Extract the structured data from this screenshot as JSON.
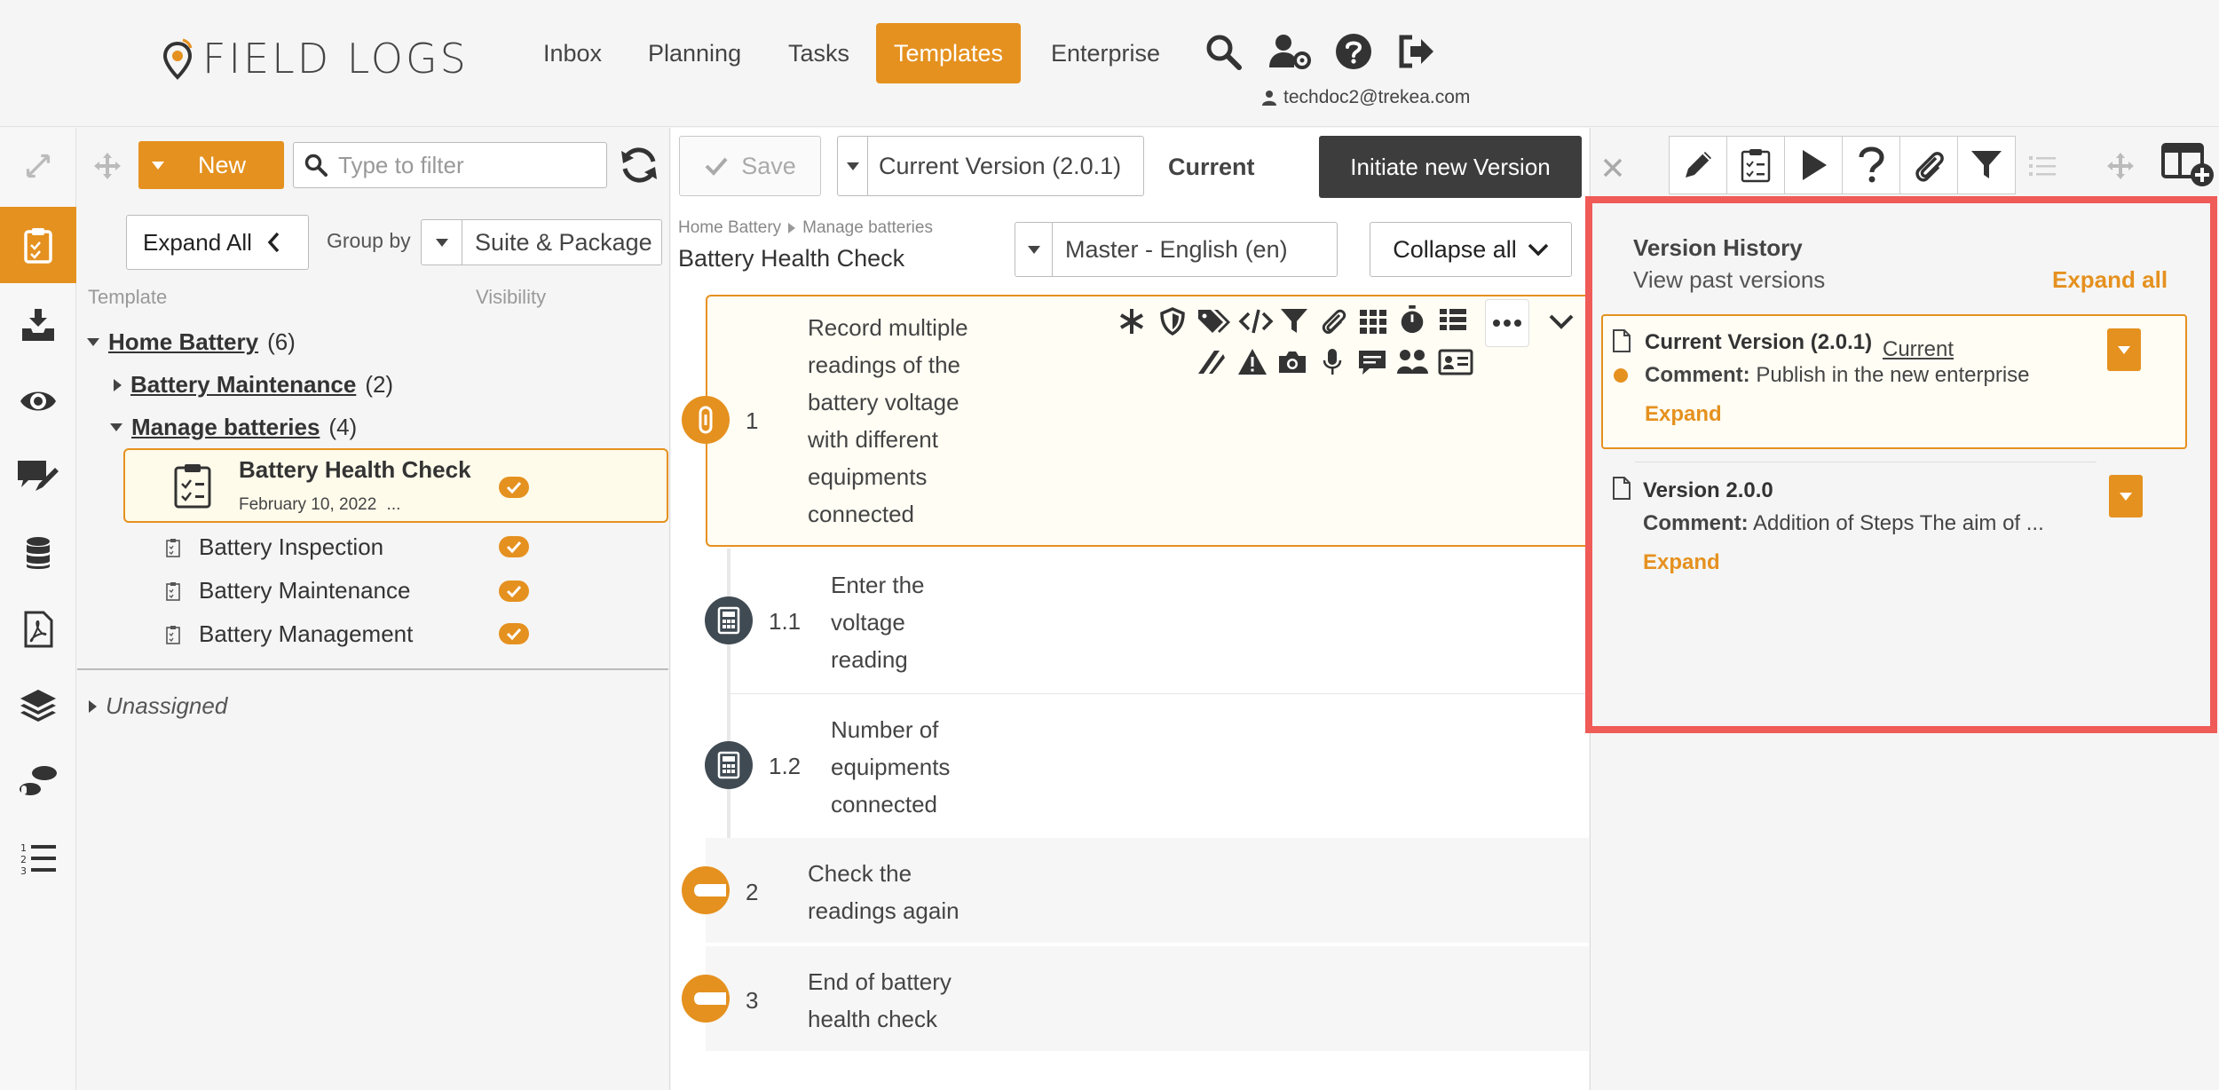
{
  "app": {
    "brand": "FIELD LOGS",
    "nav": [
      "Inbox",
      "Planning",
      "Tasks",
      "Templates",
      "Enterprise"
    ],
    "active_nav": "Templates",
    "user_email": "techdoc2@trekea.com"
  },
  "tree": {
    "new_label": "New",
    "filter_placeholder": "Type to filter",
    "expand_all_label": "Expand All",
    "group_by_label": "Group by",
    "group_by_value": "Suite & Package",
    "col_template": "Template",
    "col_visibility": "Visibility",
    "home_battery": {
      "label": "Home Battery",
      "count": "(6)"
    },
    "battery_maintenance_group": {
      "label": "Battery Maintenance",
      "count": "(2)"
    },
    "manage_batteries": {
      "label": "Manage batteries",
      "count": "(4)"
    },
    "selected_item": {
      "title": "Battery Health Check",
      "date": "February 10, 2022",
      "ellipsis": "..."
    },
    "items": [
      "Battery Inspection",
      "Battery Maintenance",
      "Battery Management"
    ],
    "unassigned": "Unassigned"
  },
  "editor": {
    "save_label": "Save",
    "version_value": "Current Version (2.0.1)",
    "current_label": "Current",
    "initiate_label": "Initiate new Version",
    "breadcrumb": [
      "Home Battery",
      "Manage batteries"
    ],
    "title": "Battery Health Check",
    "language_value": "Master - English (en)",
    "collapse_label": "Collapse all",
    "steps": [
      {
        "num": "1",
        "text": [
          "Record multiple",
          "readings of the",
          "battery voltage",
          "with different",
          "equipments",
          "connected"
        ]
      },
      {
        "num": "1.1",
        "text": [
          "Enter the",
          "voltage",
          "reading"
        ]
      },
      {
        "num": "1.2",
        "text": [
          "Number of",
          "equipments",
          "connected"
        ]
      },
      {
        "num": "2",
        "text": [
          "Check the",
          "readings again"
        ]
      },
      {
        "num": "3",
        "text": [
          "End of battery",
          "health check"
        ]
      }
    ]
  },
  "version_history": {
    "title": "Version History",
    "subtitle": "View past versions",
    "expand_all": "Expand all",
    "versions": [
      {
        "title": "Current Version (2.0.1)",
        "badge": "Current",
        "comment_label": "Comment:",
        "comment": "Publish in the new enterprise",
        "expand": "Expand"
      },
      {
        "title": "Version 2.0.0",
        "comment_label": "Comment:",
        "comment": "Addition of Steps The aim of ...",
        "expand": "Expand"
      }
    ]
  },
  "colors": {
    "accent": "#e5911f",
    "dark_button": "#3d3d3d",
    "highlight_border": "#ef5b57"
  }
}
